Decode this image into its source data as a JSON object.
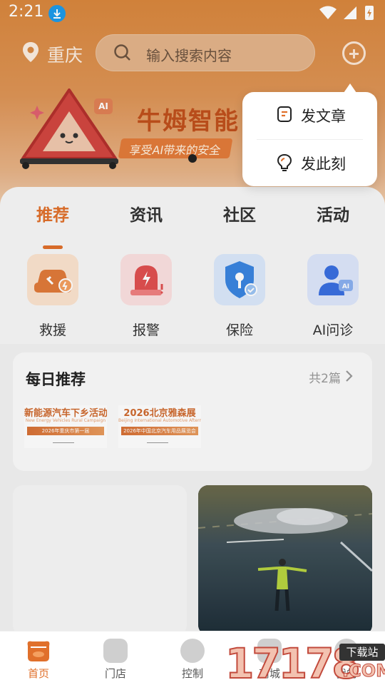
{
  "status_bar": {
    "time": "2:21"
  },
  "header": {
    "location": "重庆",
    "search_placeholder": "输入搜索内容"
  },
  "banner": {
    "title": "牛姆智能",
    "subtitle": "享受AI带来的安全",
    "ai_tag": "AI"
  },
  "popup_menu": {
    "items": [
      {
        "label": "发文章",
        "icon": "article-icon"
      },
      {
        "label": "发此刻",
        "icon": "lightbulb-icon"
      }
    ]
  },
  "tabs": [
    {
      "label": "推荐",
      "active": true
    },
    {
      "label": "资讯",
      "active": false
    },
    {
      "label": "社区",
      "active": false
    },
    {
      "label": "活动",
      "active": false
    }
  ],
  "quick_actions": [
    {
      "label": "救援",
      "icon": "rescue-car-icon",
      "color": "#e07a3a"
    },
    {
      "label": "报警",
      "icon": "alarm-icon",
      "color": "#e04a4a"
    },
    {
      "label": "保险",
      "icon": "insurance-shield-icon",
      "color": "#3a7fe0"
    },
    {
      "label": "AI问诊",
      "icon": "ai-consult-icon",
      "color": "#3a6fe0"
    }
  ],
  "daily": {
    "title": "每日推荐",
    "count": "共2篇",
    "thumbs": [
      {
        "title": "新能源汽车下乡活动",
        "sub": "New Energy Vehicles Rural Campaign",
        "bar": "2026年重庆市第一届"
      },
      {
        "title": "2026北京雅森展",
        "sub": "Beijing International Automotive Aftermarket Trade Fiesta",
        "bar": "2026年中国北京汽车用品展览会"
      }
    ]
  },
  "bottom_nav": [
    {
      "label": "首页",
      "icon": "home-icon",
      "active": true
    },
    {
      "label": "门店",
      "icon": "store-icon",
      "active": false
    },
    {
      "label": "控制",
      "icon": "control-icon",
      "active": false
    },
    {
      "label": "商城",
      "icon": "mall-icon",
      "active": false
    },
    {
      "label": "我的",
      "icon": "profile-icon",
      "active": false
    }
  ],
  "watermark": {
    "number": "17178",
    "box": "下载站",
    "suffix": ".COM"
  },
  "colors": {
    "accent": "#e0702b",
    "header": "#d9873d"
  }
}
